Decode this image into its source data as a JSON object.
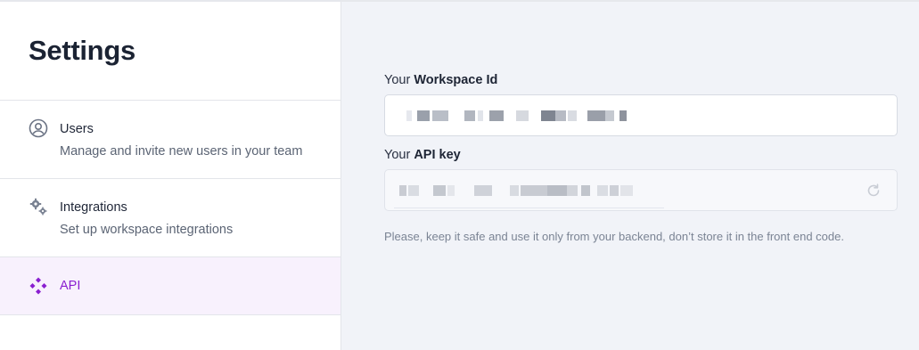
{
  "sidebar": {
    "title": "Settings",
    "items": [
      {
        "label": "Users",
        "description": "Manage and invite new users in your team",
        "icon": "user-circle-icon"
      },
      {
        "label": "Integrations",
        "description": "Set up workspace integrations",
        "icon": "gears-icon"
      },
      {
        "label": "API",
        "description": "",
        "icon": "api-diamond-icon"
      }
    ]
  },
  "main": {
    "workspace": {
      "label_prefix": "Your",
      "label_strong": "Workspace Id",
      "value_redacted": true
    },
    "api_key": {
      "label_prefix": "Your",
      "label_strong": "API key",
      "value_redacted": true,
      "refresh_icon": "refresh-icon"
    },
    "hint": "Please, keep it safe and use it only from your backend, don’t store it in the front end code."
  },
  "colors": {
    "accent": "#8a1fd0",
    "active_bg": "#f8f1fd",
    "main_bg": "#f1f3f8",
    "title": "#1b2333"
  }
}
